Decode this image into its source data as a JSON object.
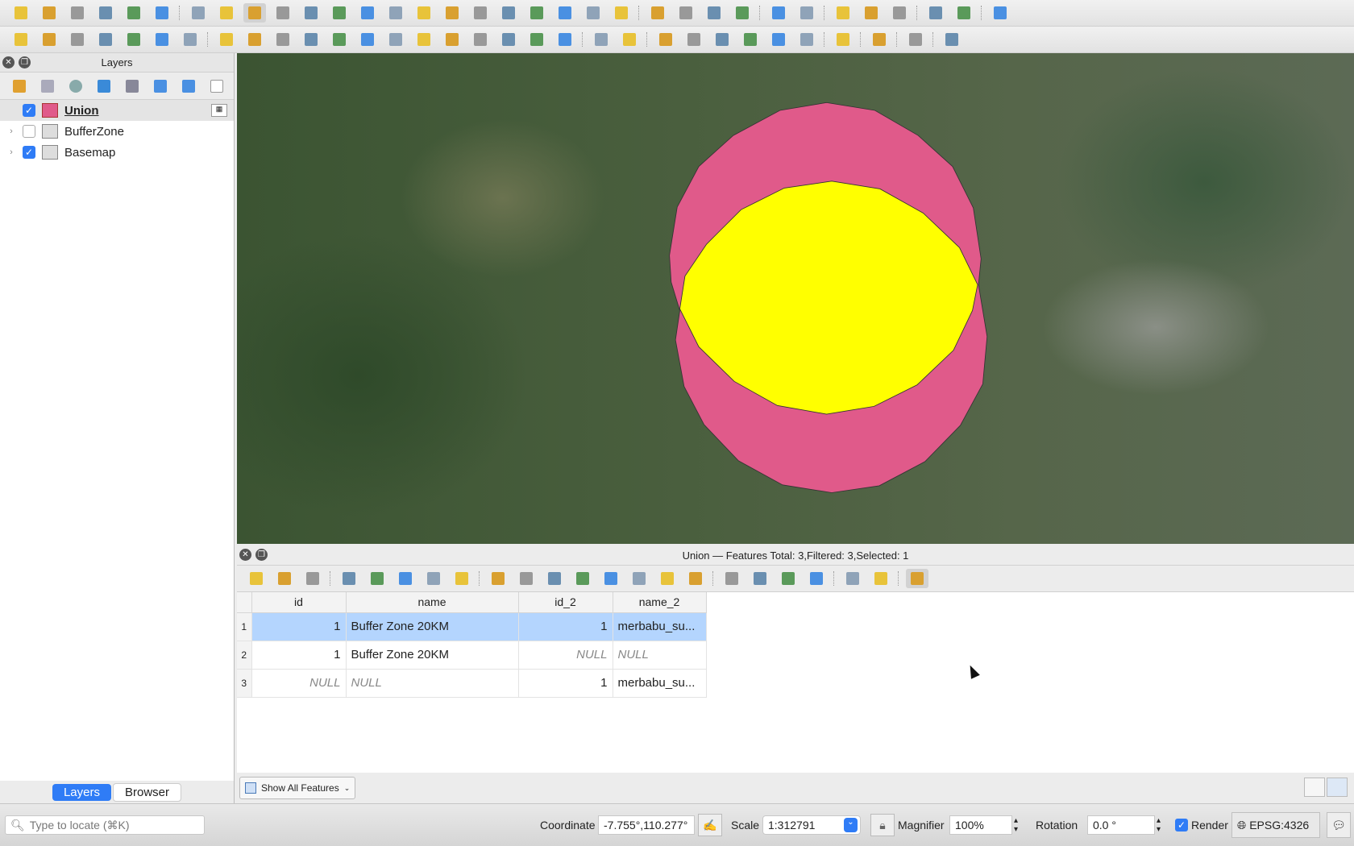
{
  "toolbar1": {
    "icons": [
      "new-project",
      "open-project",
      "save-project",
      "save-as",
      "print-layout",
      "style-manager",
      "pan",
      "pan-to-selection",
      "zoom-in",
      "zoom-out",
      "zoom-full",
      "zoom-selection",
      "zoom-layer",
      "zoom-native",
      "zoom-last",
      "zoom-next",
      "new-bookmark",
      "show-bookmarks",
      "new-spatial-bookmark",
      "map-tips",
      "temporal-controller",
      "refresh",
      "select-features",
      "select-by-expression",
      "deselect",
      "select-location",
      "identify",
      "attribute-table",
      "processing-toolbox",
      "statistics",
      "open-field-calc",
      "measure",
      "annotation",
      "locator"
    ]
  },
  "toolbar2": {
    "icons": [
      "data-source-manager",
      "new-geopackage",
      "new-shapefile",
      "new-temp-scratch",
      "new-virtual-layer",
      "new-mesh",
      "new-vector-tile",
      "current-edits",
      "toggle-editing",
      "save-edits",
      "digitize",
      "add-polygon",
      "vertex-tool",
      "modify-attributes",
      "delete-selected",
      "cut",
      "copy",
      "paste",
      "undo",
      "redo",
      "label-tool",
      "diagram-tool",
      "pin-labels",
      "show-hide-labels",
      "move-label",
      "rotate-label",
      "change-label",
      "label-properties",
      "georeferencer",
      "python-console",
      "plugin-info",
      "help"
    ]
  },
  "layers_panel": {
    "title": "Layers",
    "layers": [
      {
        "name": "Union",
        "checked": true,
        "color": "#e05a8a",
        "bold": true
      },
      {
        "name": "BufferZone",
        "checked": false
      },
      {
        "name": "Basemap",
        "checked": true
      }
    ],
    "tabs": [
      "Layers",
      "Browser"
    ],
    "active_tab": "Layers"
  },
  "map": {
    "union_color": "#e05a8a",
    "overlap_color": "#ffff00"
  },
  "attribute_table": {
    "title": "Union — Features Total: 3,Filtered: 3,Selected: 1",
    "columns": [
      "id",
      "name",
      "id_2",
      "name_2"
    ],
    "rows": [
      {
        "n": "1",
        "id": "1",
        "name": "Buffer Zone 20KM",
        "id_2": "1",
        "name_2": "merbabu_su...",
        "selected": true
      },
      {
        "n": "2",
        "id": "1",
        "name": "Buffer Zone 20KM",
        "id_2": "NULL",
        "name_2": "NULL"
      },
      {
        "n": "3",
        "id": "NULL",
        "name": "NULL",
        "id_2": "1",
        "name_2": "merbabu_su..."
      }
    ],
    "filter_button": "Show All Features"
  },
  "status": {
    "locate_placeholder": "Type to locate (⌘K)",
    "coordinate_label": "Coordinate",
    "coordinate": "-7.755°,110.277°",
    "scale_label": "Scale",
    "scale": "1:312791",
    "magnifier_label": "Magnifier",
    "magnifier": "100%",
    "rotation_label": "Rotation",
    "rotation": "0.0 °",
    "render_label": "Render",
    "render": true,
    "crs": "EPSG:4326"
  }
}
